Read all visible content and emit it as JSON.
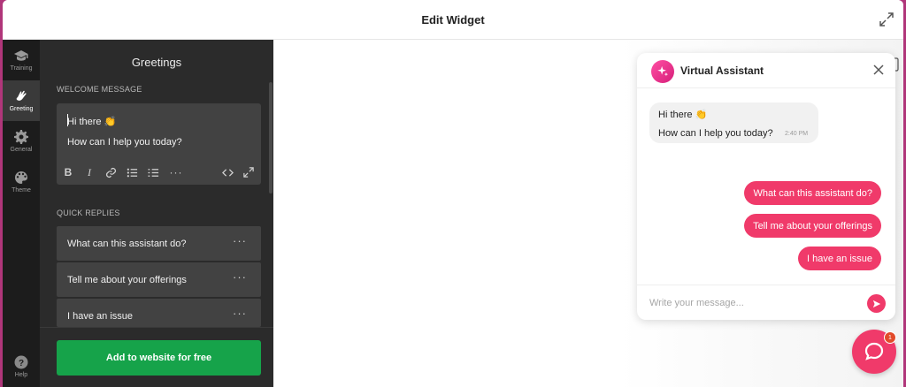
{
  "topbar": {
    "title": "Edit Widget"
  },
  "rail": {
    "items": [
      {
        "label": "Training",
        "icon": "graduation-cap-icon"
      },
      {
        "label": "Greeting",
        "icon": "waving-hand-icon"
      },
      {
        "label": "General",
        "icon": "gear-icon"
      },
      {
        "label": "Theme",
        "icon": "palette-icon"
      }
    ],
    "help_label": "Help",
    "active": "Greeting"
  },
  "panel": {
    "title": "Greetings",
    "welcome_label": "WELCOME MESSAGE",
    "welcome_line1": "Hi there 👏",
    "welcome_line2": "How can I help you today?",
    "quick_replies_label": "QUICK REPLIES",
    "quick_replies": [
      "What can this assistant do?",
      "Tell me about your offerings",
      "I have an issue"
    ],
    "more_label": "···",
    "add_button": "Add to website for free"
  },
  "chat": {
    "title": "Virtual Assistant",
    "bot_line1": "Hi there 👏",
    "bot_line2": "How can I help you today?",
    "time": "2:40 PM",
    "quick_replies": [
      "What can this assistant do?",
      "Tell me about your offerings",
      "I have an issue"
    ],
    "input_placeholder": "Write your message...",
    "badge_count": "1"
  },
  "colors": {
    "accent": "#f03a6a",
    "add_button": "#16a34a",
    "panel_bg": "#2b2b2b",
    "rail_bg": "#1c1c1c"
  }
}
